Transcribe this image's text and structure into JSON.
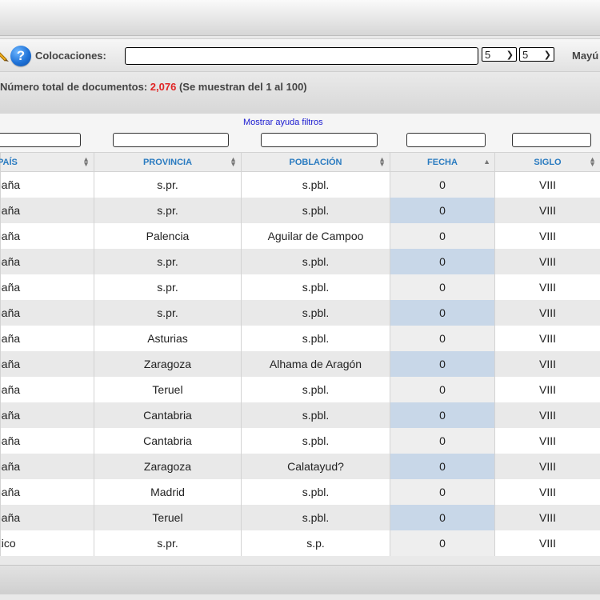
{
  "toolbar": {
    "colocaciones_label": "Colocaciones:",
    "colocaciones_value": "",
    "select_left": "5",
    "select_right": "5",
    "mayus_label": "Mayú"
  },
  "summary": {
    "prefix": "Número total de documentos: ",
    "count": "2,076",
    "suffix": " (Se muestran del 1 al 100)"
  },
  "filters": {
    "help_link": "Mostrar ayuda filtros"
  },
  "table": {
    "columns": [
      "PAÍS",
      "PROVINCIA",
      "POBLACIÓN",
      "FECHA",
      "SIGLO"
    ],
    "rows": [
      [
        "spaña",
        "s.pr.",
        "s.pbl.",
        "0",
        "VIII"
      ],
      [
        "spaña",
        "s.pr.",
        "s.pbl.",
        "0",
        "VIII"
      ],
      [
        "spaña",
        "Palencia",
        "Aguilar de Campoo",
        "0",
        "VIII"
      ],
      [
        "spaña",
        "s.pr.",
        "s.pbl.",
        "0",
        "VIII"
      ],
      [
        "spaña",
        "s.pr.",
        "s.pbl.",
        "0",
        "VIII"
      ],
      [
        "spaña",
        "s.pr.",
        "s.pbl.",
        "0",
        "VIII"
      ],
      [
        "spaña",
        "Asturias",
        "s.pbl.",
        "0",
        "VIII"
      ],
      [
        "spaña",
        "Zaragoza",
        "Alhama de Aragón",
        "0",
        "VIII"
      ],
      [
        "spaña",
        "Teruel",
        "s.pbl.",
        "0",
        "VIII"
      ],
      [
        "spaña",
        "Cantabria",
        "s.pbl.",
        "0",
        "VIII"
      ],
      [
        "spaña",
        "Cantabria",
        "s.pbl.",
        "0",
        "VIII"
      ],
      [
        "spaña",
        "Zaragoza",
        "Calatayud?",
        "0",
        "VIII"
      ],
      [
        "spaña",
        "Madrid",
        "s.pbl.",
        "0",
        "VIII"
      ],
      [
        "spaña",
        "Teruel",
        "s.pbl.",
        "0",
        "VIII"
      ],
      [
        "éxico",
        "s.pr.",
        "s.p.",
        "0",
        "VIII"
      ]
    ]
  }
}
